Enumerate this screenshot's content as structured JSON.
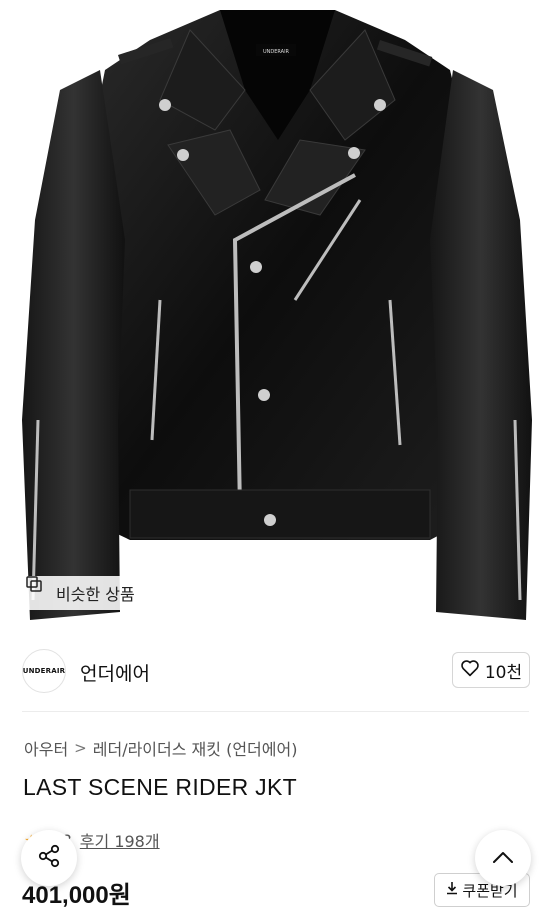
{
  "product_image": {
    "alt": "leather rider jacket",
    "label_on_jacket": "UNDERAIR"
  },
  "similar_button": {
    "label": "비슷한 상품",
    "icon": "similar-items-icon"
  },
  "brand": {
    "logo_text": "UNDERAIR",
    "name": "언더에어",
    "like_label": "10천",
    "like_icon": "heart-outline-icon"
  },
  "breadcrumb": {
    "items": [
      "아우터",
      "레더/라이더스 재킷 (언더에어)"
    ],
    "separator": ">"
  },
  "product": {
    "title": "LAST SCENE RIDER JKT",
    "rating": "4.8",
    "review_label": "후기 198개",
    "price": "401,000원"
  },
  "coupon": {
    "label": "쿠폰받기",
    "icon": "download-icon"
  },
  "fab": {
    "share_icon": "share-icon",
    "top_icon": "chevron-up-icon"
  },
  "colors": {
    "accent_star": "#f5a623",
    "text_primary": "#111111",
    "text_secondary": "#555555",
    "border": "#d6d6d6"
  }
}
